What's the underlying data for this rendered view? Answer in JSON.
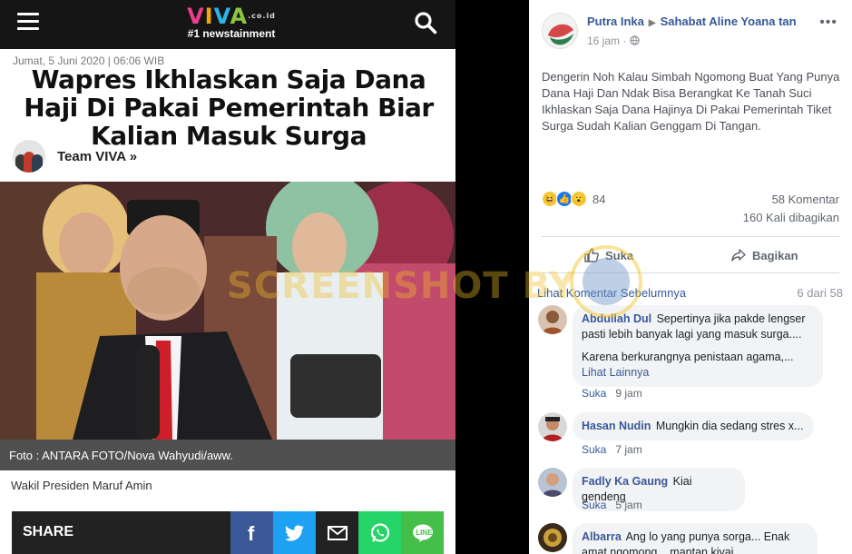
{
  "viva": {
    "logo_word": "VIVA",
    "logo_domain": ".co.id",
    "logo_tagline": "#1 newstainment",
    "date": "Jumat, 5 Juni 2020 | 06:06 WIB",
    "headline": "Wapres Ikhlaskan Saja Dana Haji Di Pakai Pemerintah Biar Kalian Masuk Surga",
    "author": "Team VIVA »",
    "photo_caption": "Foto :  ANTARA FOTO/Nova Wahyudi/aww.",
    "sub_caption": "Wakil Presiden Maruf Amin",
    "share_label": "SHARE",
    "share_buttons": [
      "facebook",
      "twitter",
      "email",
      "whatsapp",
      "line"
    ],
    "colors": {
      "facebook": "#3b5998",
      "twitter": "#1da1f2",
      "email": "#222222",
      "whatsapp": "#25d366",
      "line": "#44c04a"
    }
  },
  "watermark": "SCREENSHOT BY",
  "post": {
    "author": "Putra Inka",
    "target": "Sahabat Aline Yoana tan",
    "time": "16 jam",
    "body": "Dengerin Noh Kalau Simbah Ngomong Buat Yang Punya Dana Haji Dan Ndak Bisa Berangkat Ke Tanah Suci Ikhlaskan Saja Dana Hajinya Di Pakai Pemerintah Tiket Surga Sudah Kalian Genggam Di Tangan.",
    "reaction_count": "84",
    "comments_count": "58 Komentar",
    "shares_count": "160 Kali dibagikan",
    "like_label": "Suka",
    "share_label": "Bagikan",
    "prev_comments_label": "Lihat Komentar Sebelumnya",
    "prev_comments_count": "6 dari 58"
  },
  "comments": [
    {
      "name": "Abdullah Dul",
      "text": "Sepertinya jika pakde lengser pasti lebih banyak lagi yang masuk surga....",
      "text2": "Karena berkurangnya penistaan agama,...",
      "more": "Lihat Lainnya",
      "like": "Suka",
      "time": "9 jam"
    },
    {
      "name": "Hasan Nudin",
      "text": "Mungkin dia sedang stres x...",
      "like": "Suka",
      "time": "7 jam"
    },
    {
      "name": "Fadly Ka Gaung",
      "text": "Kiai gendeng",
      "like": "Suka",
      "time": "5 jam"
    },
    {
      "name": "Albarra",
      "text": "Ang lo yang punya sorga... Enak amat ngomong... mantan kiyai"
    }
  ]
}
